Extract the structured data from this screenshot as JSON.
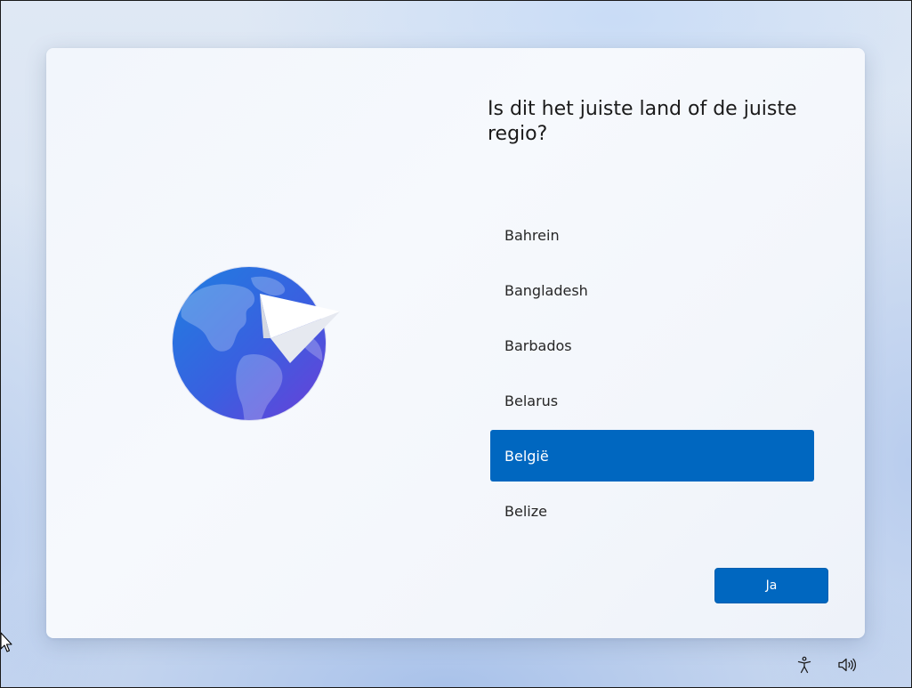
{
  "oobe": {
    "title": "Is dit het juiste land of de juiste regio?",
    "countries": [
      "Bahrein",
      "Bangladesh",
      "Barbados",
      "Belarus",
      "België",
      "Belize"
    ],
    "selected_country": "België",
    "next_button_label": "Ja"
  },
  "illustration": {
    "icon": "globe-with-paper-plane-icon"
  },
  "taskbar": {
    "icons": [
      "accessibility-icon",
      "volume-icon"
    ]
  },
  "colors": {
    "accent": "#0067c0",
    "selected_text": "#ffffff",
    "title_text": "#1b1b1b"
  }
}
